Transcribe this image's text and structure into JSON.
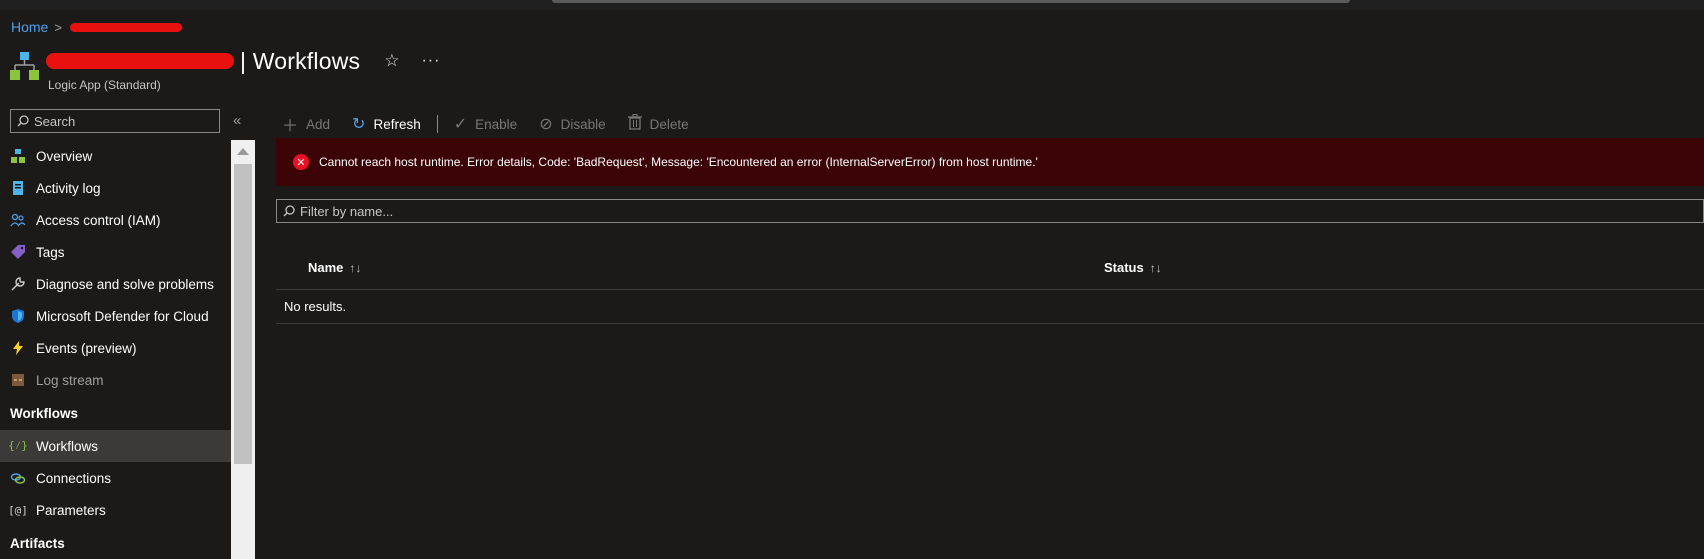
{
  "breadcrumb": {
    "home": "Home",
    "separator": ">"
  },
  "header": {
    "title": "| Workflows",
    "subtitle": "Logic App (Standard)",
    "favorite_icon": "star-icon",
    "more_label": "···"
  },
  "sidebar": {
    "search_placeholder": "Search",
    "collapse_label": "«",
    "items": [
      {
        "label": "Overview",
        "icon": "overview-icon"
      },
      {
        "label": "Activity log",
        "icon": "activity-log-icon"
      },
      {
        "label": "Access control (IAM)",
        "icon": "people-icon"
      },
      {
        "label": "Tags",
        "icon": "tag-icon"
      },
      {
        "label": "Diagnose and solve problems",
        "icon": "wrench-icon"
      },
      {
        "label": "Microsoft Defender for Cloud",
        "icon": "shield-icon"
      },
      {
        "label": "Events (preview)",
        "icon": "lightning-icon"
      },
      {
        "label": "Log stream",
        "icon": "log-stream-icon"
      }
    ],
    "group_workflows": "Workflows",
    "workflow_items": [
      {
        "label": "Workflows",
        "icon": "workflow-icon"
      },
      {
        "label": "Connections",
        "icon": "link-icon"
      },
      {
        "label": "Parameters",
        "icon": "parameters-icon"
      }
    ],
    "group_artifacts": "Artifacts"
  },
  "toolbar": {
    "add": "Add",
    "refresh": "Refresh",
    "enable": "Enable",
    "disable": "Disable",
    "delete": "Delete"
  },
  "error": {
    "message": "Cannot reach host runtime. Error details, Code: 'BadRequest', Message: 'Encountered an error (InternalServerError) from host runtime.'"
  },
  "filter": {
    "placeholder": "Filter by name..."
  },
  "table": {
    "columns": [
      "Name",
      "Status"
    ],
    "empty_text": "No results."
  },
  "colors": {
    "accent": "#4f9fe8",
    "error_bg": "#3b0306",
    "error_icon": "#e81123",
    "redaction": "#e8110f"
  }
}
